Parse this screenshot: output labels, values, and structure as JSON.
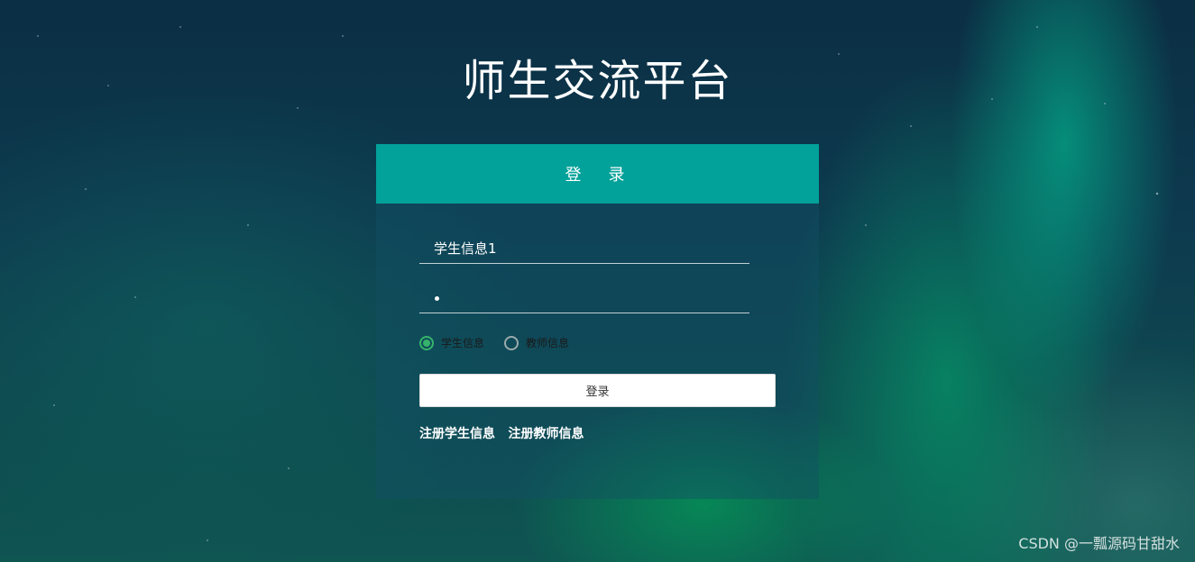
{
  "page": {
    "title": "师生交流平台"
  },
  "login_panel": {
    "header": "登　录",
    "username": {
      "value": "学生信息1"
    },
    "password": {
      "value": "•"
    },
    "roles": [
      {
        "label": "学生信息",
        "selected": true
      },
      {
        "label": "教师信息",
        "selected": false
      }
    ],
    "submit_label": "登录",
    "links": {
      "register_student": "注册学生信息",
      "register_teacher": "注册教师信息"
    }
  },
  "watermark": "CSDN @一瓢源码甘甜水",
  "colors": {
    "header": "#02a199",
    "radio_selected": "#36b36a"
  }
}
